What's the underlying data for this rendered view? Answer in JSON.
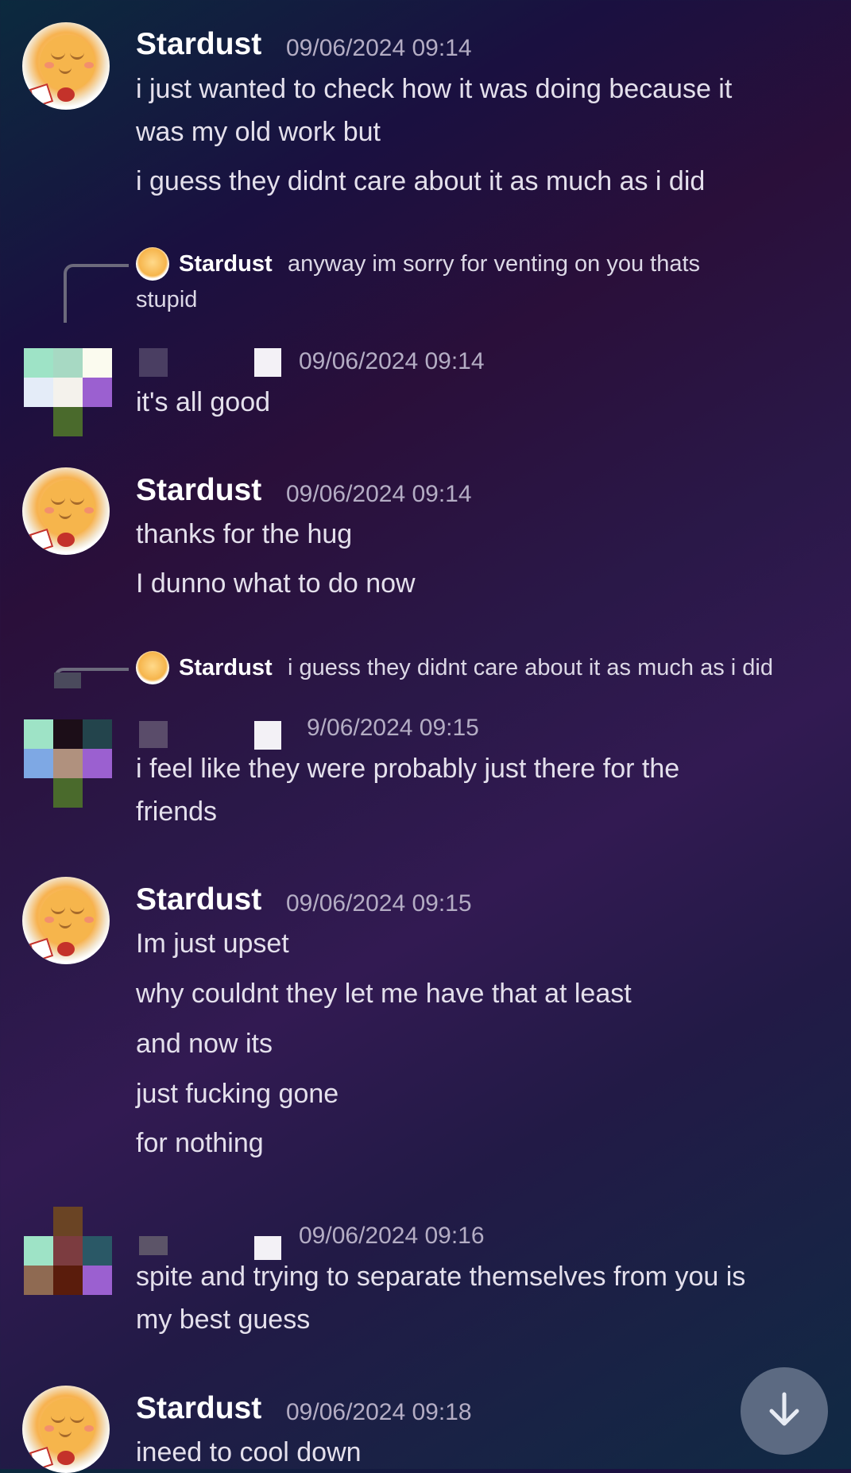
{
  "messages": [
    {
      "author": "Stardust",
      "time": "09/06/2024 09:14",
      "lines": [
        "i just wanted to check how it was doing  because it",
        "was my old work but",
        "i guess they didnt care about it as much as i did"
      ]
    },
    {
      "reply_to": {
        "author": "Stardust",
        "text": "anyway im sorry for venting on you thats",
        "text_cont": "stupid"
      },
      "time": "09/06/2024 09:14",
      "lines": [
        "it's all good"
      ]
    },
    {
      "author": "Stardust",
      "time": "09/06/2024 09:14",
      "lines": [
        "thanks for the hug",
        "I dunno what to do now"
      ]
    },
    {
      "reply_to": {
        "author": "Stardust",
        "text": "i guess they didnt care about it as much as i did"
      },
      "time": "9/06/2024 09:15",
      "lines": [
        "i feel like they were probably just there for the",
        "friends"
      ]
    },
    {
      "author": "Stardust",
      "time": "09/06/2024 09:15",
      "lines": [
        "Im just upset",
        "why couldnt they let me have that at least",
        "and now its",
        "just fucking gone",
        "for nothing"
      ]
    },
    {
      "time": "09/06/2024 09:16",
      "lines": [
        "spite and trying to separate themselves from you is",
        "my best guess"
      ]
    },
    {
      "author": "Stardust",
      "time": "09/06/2024 09:18",
      "lines": [
        "ineed to cool down"
      ]
    }
  ],
  "icons": {
    "scroll_down": "arrow-down-icon"
  },
  "colors": {
    "scroll_button": "#5c6a82",
    "username": "#ffffff",
    "timestamp": "#b4adc4"
  }
}
